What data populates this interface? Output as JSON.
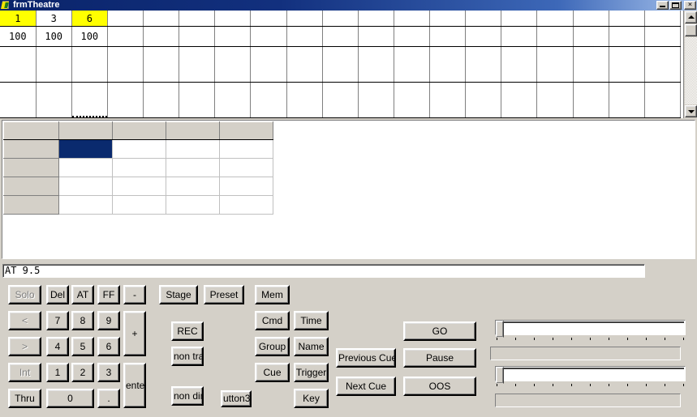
{
  "window": {
    "title": "frmTheatre",
    "icon": "vb-form-icon",
    "minimize_label": "_",
    "maximize_label": "□",
    "close_label": "×"
  },
  "channel_grid": {
    "columns": 19,
    "rows": [
      {
        "type": "header",
        "cells": [
          {
            "text": "1",
            "highlight": true
          },
          {
            "text": "3",
            "highlight": false
          },
          {
            "text": "6",
            "highlight": true
          },
          {
            "text": "",
            "highlight": false
          },
          {
            "text": "",
            "highlight": false
          },
          {
            "text": "",
            "highlight": false
          },
          {
            "text": "",
            "highlight": false
          },
          {
            "text": "",
            "highlight": false
          },
          {
            "text": "",
            "highlight": false
          },
          {
            "text": "",
            "highlight": false
          },
          {
            "text": "",
            "highlight": false
          },
          {
            "text": "",
            "highlight": false
          },
          {
            "text": "",
            "highlight": false
          },
          {
            "text": "",
            "highlight": false
          },
          {
            "text": "",
            "highlight": false
          },
          {
            "text": "",
            "highlight": false
          },
          {
            "text": "",
            "highlight": false
          },
          {
            "text": "",
            "highlight": false
          },
          {
            "text": "",
            "highlight": false
          }
        ]
      },
      {
        "type": "value",
        "cells": [
          {
            "text": "100"
          },
          {
            "text": "100"
          },
          {
            "text": "100"
          },
          {
            "text": ""
          },
          {
            "text": ""
          },
          {
            "text": ""
          },
          {
            "text": ""
          },
          {
            "text": ""
          },
          {
            "text": ""
          },
          {
            "text": ""
          },
          {
            "text": ""
          },
          {
            "text": ""
          },
          {
            "text": ""
          },
          {
            "text": ""
          },
          {
            "text": ""
          },
          {
            "text": ""
          },
          {
            "text": ""
          },
          {
            "text": ""
          },
          {
            "text": ""
          }
        ]
      }
    ],
    "scrollbar": {
      "up_arrow": "▲",
      "down_arrow": "▼"
    }
  },
  "cue_grid": {
    "column_headers": [
      "",
      "",
      "",
      "",
      ""
    ],
    "rows": [
      {
        "header": "",
        "cells": [
          "",
          "",
          "",
          ""
        ],
        "selected_index": 0
      },
      {
        "header": "",
        "cells": [
          "",
          "",
          "",
          ""
        ],
        "selected_index": -1
      },
      {
        "header": "",
        "cells": [
          "",
          "",
          "",
          ""
        ],
        "selected_index": -1
      },
      {
        "header": "",
        "cells": [
          "",
          "",
          "",
          ""
        ],
        "selected_index": -1
      }
    ],
    "selection_color": "#0a2a6e"
  },
  "command_line": {
    "value": "AT 9.5",
    "placeholder": ""
  },
  "keypad": {
    "row1": [
      {
        "label": "Solo",
        "disabled": true
      },
      {
        "label": "Del",
        "disabled": false
      },
      {
        "label": "AT",
        "disabled": false
      },
      {
        "label": "FF",
        "disabled": false
      },
      {
        "label": "-",
        "disabled": false
      }
    ],
    "row2": [
      {
        "label": "<",
        "disabled": true
      },
      {
        "label": "7",
        "disabled": false
      },
      {
        "label": "8",
        "disabled": false
      },
      {
        "label": "9",
        "disabled": false
      }
    ],
    "row3": [
      {
        "label": ">",
        "disabled": true
      },
      {
        "label": "4",
        "disabled": false
      },
      {
        "label": "5",
        "disabled": false
      },
      {
        "label": "6",
        "disabled": false
      }
    ],
    "row4": [
      {
        "label": "Int",
        "disabled": true
      },
      {
        "label": "1",
        "disabled": false
      },
      {
        "label": "2",
        "disabled": false
      },
      {
        "label": "3",
        "disabled": false
      }
    ],
    "row5": [
      {
        "label": "Thru",
        "disabled": false
      },
      {
        "label": "0",
        "disabled": false
      },
      {
        "label": ".",
        "disabled": false
      }
    ],
    "plus_label": "+",
    "enter_label": "enter"
  },
  "mode_buttons": {
    "stage": "Stage",
    "preset": "Preset",
    "rec": "REC",
    "non_track": "non trac",
    "non_dim": "non dim",
    "button3": "utton3"
  },
  "attribute_buttons": {
    "mem": "Mem",
    "cmd": "Cmd",
    "time": "Time",
    "group": "Group",
    "name": "Name",
    "cue": "Cue",
    "trigger": "Trigger",
    "key": "Key"
  },
  "playback_buttons": {
    "previous_cue": "Previous Cue",
    "next_cue": "Next Cue",
    "go": "GO",
    "pause": "Pause",
    "oos": "OOS"
  },
  "faders": [
    {
      "name": "fader-a",
      "value": 0,
      "tick_count": 11
    },
    {
      "name": "fader-b",
      "value": 0,
      "tick_count": 11
    }
  ],
  "colors": {
    "face": "#d4d0c8",
    "highlight_yellow": "#ffff00",
    "selection_navy": "#0a2a6e",
    "title_blue": "#0a246a"
  }
}
